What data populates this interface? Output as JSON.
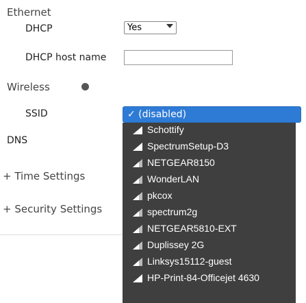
{
  "ethernet": {
    "title": "Ethernet",
    "dhcp_label": "DHCP",
    "dhcp_value": "Yes",
    "dhcp_hostname_label": "DHCP host name",
    "dhcp_hostname_value": ""
  },
  "wireless": {
    "title": "Wireless",
    "ssid_label": "SSID",
    "dns_label": "DNS",
    "ssid_selected": "✓ (disabled)",
    "networks": [
      {
        "name": "Schottify",
        "signal": "strong"
      },
      {
        "name": "SpectrumSetup-D3",
        "signal": "strong"
      },
      {
        "name": "NETGEAR8150",
        "signal": "medium"
      },
      {
        "name": "WonderLAN",
        "signal": "medium"
      },
      {
        "name": "pkcox",
        "signal": "medium"
      },
      {
        "name": "spectrum2g",
        "signal": "medium"
      },
      {
        "name": "NETGEAR5810-EXT",
        "signal": "medium"
      },
      {
        "name": "Duplissey 2G",
        "signal": "medium"
      },
      {
        "name": "Linksys15112-guest",
        "signal": "medium"
      },
      {
        "name": "HP-Print-84-Officejet 4630",
        "signal": "strong"
      }
    ]
  },
  "time_settings": {
    "label": "+ Time Settings"
  },
  "security_settings": {
    "label": "+ Security Settings"
  },
  "colors": {
    "accent": "#2e7bd6",
    "dropdown_bg": "#3f3f3f"
  }
}
